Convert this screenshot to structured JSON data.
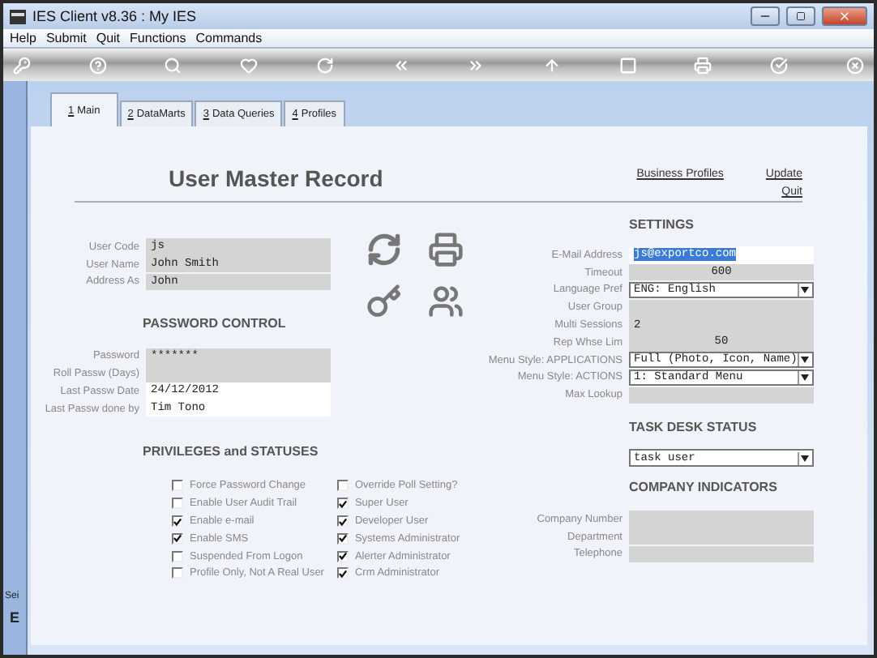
{
  "window": {
    "title": "IES Client v8.36 : My IES"
  },
  "menu": [
    "Help",
    "Submit",
    "Quit",
    "Functions",
    "Commands"
  ],
  "tabs": [
    {
      "hotkey": "1",
      "label": "Main",
      "selected": true
    },
    {
      "hotkey": "2",
      "label": "DataMarts",
      "selected": false
    },
    {
      "hotkey": "3",
      "label": "Data Queries",
      "selected": false
    },
    {
      "hotkey": "4",
      "label": "Profiles",
      "selected": false
    }
  ],
  "sidebar": {
    "texts": [
      "Sei",
      "E"
    ]
  },
  "header": {
    "title": "User Master Record",
    "links": [
      "Business Profiles",
      "Update",
      "Quit"
    ]
  },
  "user_fields": [
    {
      "label": "User Code",
      "value": "js",
      "readonly": true
    },
    {
      "label": "User Name",
      "value": "John Smith",
      "readonly": true
    },
    {
      "label": "Address As",
      "value": "John",
      "readonly": true
    }
  ],
  "password_control": {
    "title": "PASSWORD CONTROL",
    "fields": [
      {
        "label": "Password",
        "value": "*******",
        "readonly": true
      },
      {
        "label": "Roll Passw (Days)",
        "readonly": true
      },
      {
        "label": "Last Passw Date",
        "value": "24/12/2012",
        "readonly": false
      },
      {
        "label": "Last Passw done by",
        "value": "Tim Tono",
        "readonly": false
      }
    ]
  },
  "privileges": {
    "title": "PRIVILEGES and STATUSES",
    "columns": [
      [
        {
          "label": "Force Password Change",
          "checked": false
        },
        {
          "label": "Enable User Audit Trail",
          "checked": false
        },
        {
          "label": "Enable e-mail",
          "checked": true
        },
        {
          "label": "Enable SMS",
          "checked": true
        },
        {
          "label": "Suspended From Logon",
          "checked": false
        },
        {
          "label": "Profile Only, Not A Real User",
          "checked": false
        }
      ],
      [
        {
          "label": "Override Poll Setting?",
          "checked": false
        },
        {
          "label": "Super User",
          "checked": true
        },
        {
          "label": "Developer User",
          "checked": true
        },
        {
          "label": "Systems Administrator",
          "checked": true
        },
        {
          "label": "Alerter Administrator",
          "checked": true
        },
        {
          "label": "Crm Administrator",
          "checked": true
        }
      ]
    ]
  },
  "settings": {
    "title": "SETTINGS",
    "fields": [
      {
        "label": "E-Mail Address",
        "kind": "text",
        "value": "js@exportco.com",
        "highlighted": true
      },
      {
        "label": "Timeout",
        "kind": "number",
        "value": "600"
      },
      {
        "label": "Language Pref",
        "kind": "select",
        "value": "ENG: English"
      },
      {
        "label": "User Group",
        "kind": "text",
        "highlighted": false
      },
      {
        "label": "Multi Sessions",
        "kind": "text",
        "value": "2",
        "highlighted": false
      },
      {
        "label": "Rep Whse Lim",
        "kind": "number",
        "value": "50"
      },
      {
        "label": "Menu Style: APPLICATIONS",
        "kind": "select",
        "value": "Full (Photo, Icon, Name)"
      },
      {
        "label": "Menu Style: ACTIONS",
        "kind": "select",
        "value": "1: Standard Menu"
      },
      {
        "label": "Max Lookup",
        "kind": "text",
        "highlighted": false
      }
    ]
  },
  "task_desk": {
    "title": "TASK DESK STATUS",
    "value": "task user"
  },
  "company": {
    "title": "COMPANY INDICATORS",
    "fields": [
      {
        "label": "Company Number"
      },
      {
        "label": "Department"
      },
      {
        "label": "Telephone"
      }
    ]
  }
}
